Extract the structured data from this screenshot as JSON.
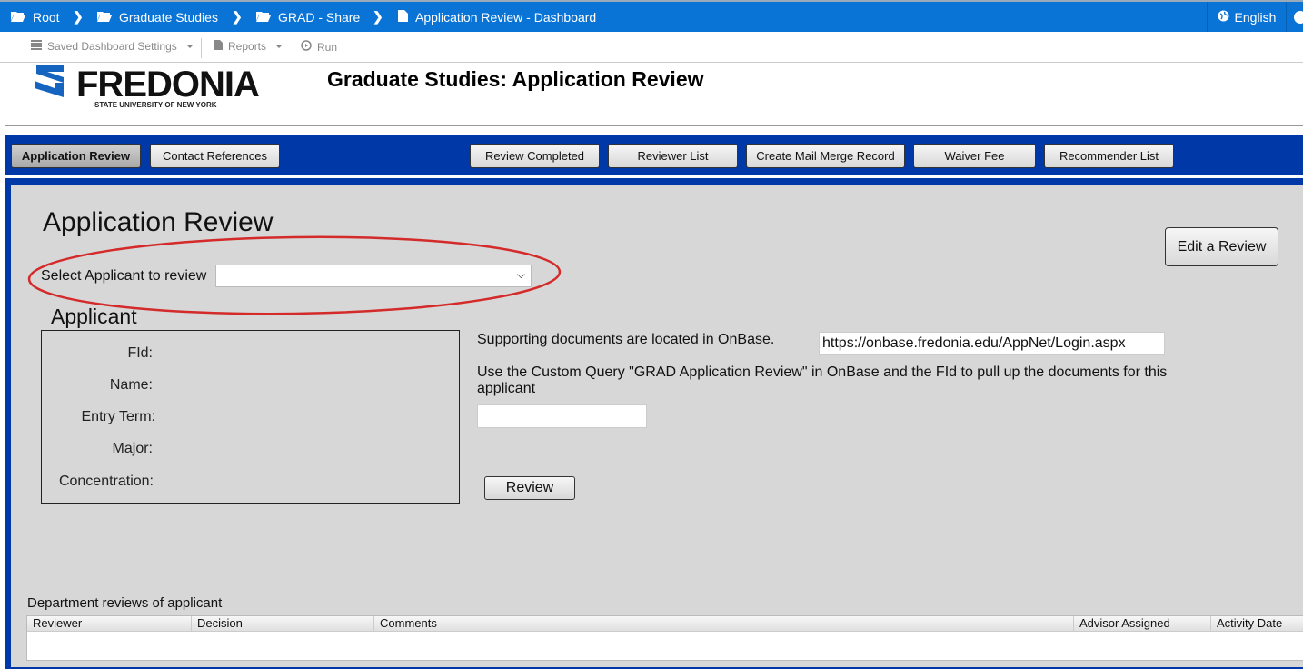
{
  "breadcrumb": [
    {
      "label": "Root",
      "icon": "folder-open-icon"
    },
    {
      "label": "Graduate Studies",
      "icon": "folder-open-icon"
    },
    {
      "label": "GRAD - Share",
      "icon": "folder-open-icon"
    },
    {
      "label": "Application Review - Dashboard",
      "icon": "file-icon"
    }
  ],
  "language": "English",
  "toolbar": {
    "saved_settings": "Saved Dashboard Settings",
    "reports": "Reports",
    "run": "Run"
  },
  "header": {
    "logo_word": "FREDONIA",
    "logo_sub": "STATE UNIVERSITY OF NEW YORK",
    "title": "Graduate Studies: Application Review"
  },
  "nav": {
    "buttons": [
      {
        "label": "Application Review",
        "active": true
      },
      {
        "label": "Contact References",
        "active": false
      },
      {
        "label": "Review Completed",
        "active": false
      },
      {
        "label": "Reviewer List",
        "active": false
      },
      {
        "label": "Create Mail Merge Record",
        "active": false
      },
      {
        "label": "Waiver Fee",
        "active": false
      },
      {
        "label": "Recommender List",
        "active": false
      }
    ]
  },
  "main": {
    "heading": "Application Review",
    "select_label": "Select Applicant to review",
    "select_value": "",
    "edit_button": "Edit a Review",
    "applicant_heading": "Applicant",
    "fields": [
      {
        "label": "FId:",
        "value": ""
      },
      {
        "label": "Name:",
        "value": ""
      },
      {
        "label": "Entry Term:",
        "value": ""
      },
      {
        "label": "Major:",
        "value": ""
      },
      {
        "label": "Concentration:",
        "value": ""
      }
    ],
    "support_text": "Supporting documents are located in OnBase.",
    "onbase_url": "https://onbase.fredonia.edu/AppNet/Login.aspx",
    "query_text": "Use the Custom Query \"GRAD Application Review\" in OnBase and the FId to pull up the documents for this applicant",
    "fid_input_value": "",
    "review_button": "Review"
  },
  "reviews": {
    "title": "Department reviews of applicant",
    "columns": [
      "Reviewer",
      "Decision",
      "Comments",
      "Advisor Assigned",
      "Activity Date"
    ],
    "rows": []
  },
  "colors": {
    "topbar": "#0a74d6",
    "nav_blue": "#0038a8",
    "panel_gray": "#d7d7d7",
    "annotation_red": "#d42a2a",
    "logo_blue": "#1565c0"
  }
}
